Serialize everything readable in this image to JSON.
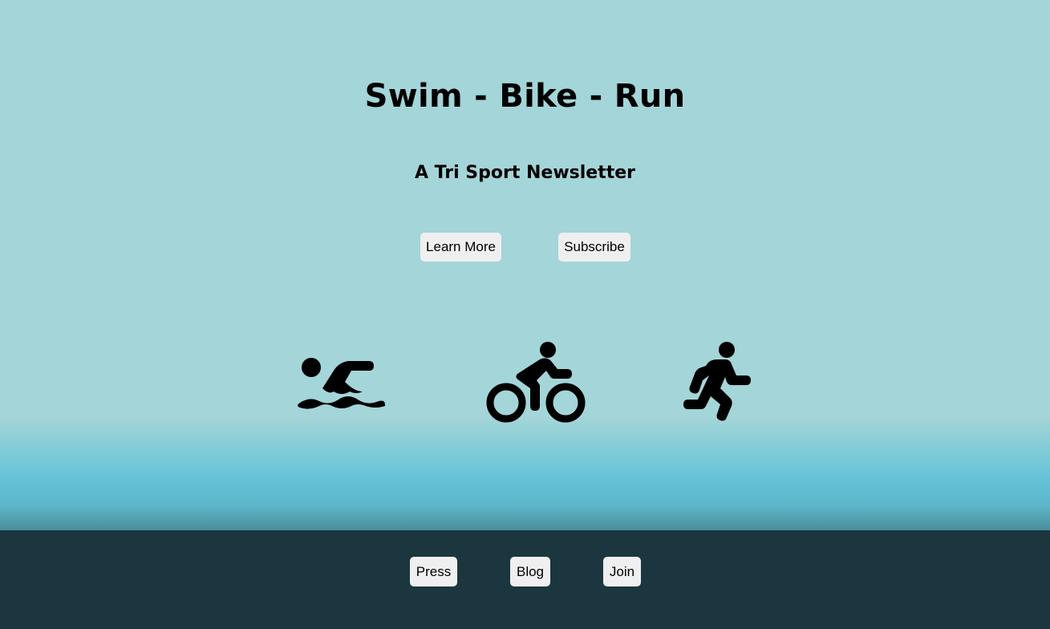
{
  "hero": {
    "title": "Swim - Bike - Run",
    "subtitle": "A Tri Sport Newsletter",
    "buttons": {
      "learn_more": "Learn More",
      "subscribe": "Subscribe"
    },
    "icons": [
      "swimmer-icon",
      "cyclist-icon",
      "runner-icon"
    ]
  },
  "footer": {
    "links": {
      "press": "Press",
      "blog": "Blog",
      "join": "Join"
    }
  },
  "colors": {
    "hero_background": "#a4d5d8",
    "water_gradient": "#63c1d6",
    "footer_background": "#1b363e",
    "button_background": "#efefef",
    "text": "#000000"
  }
}
